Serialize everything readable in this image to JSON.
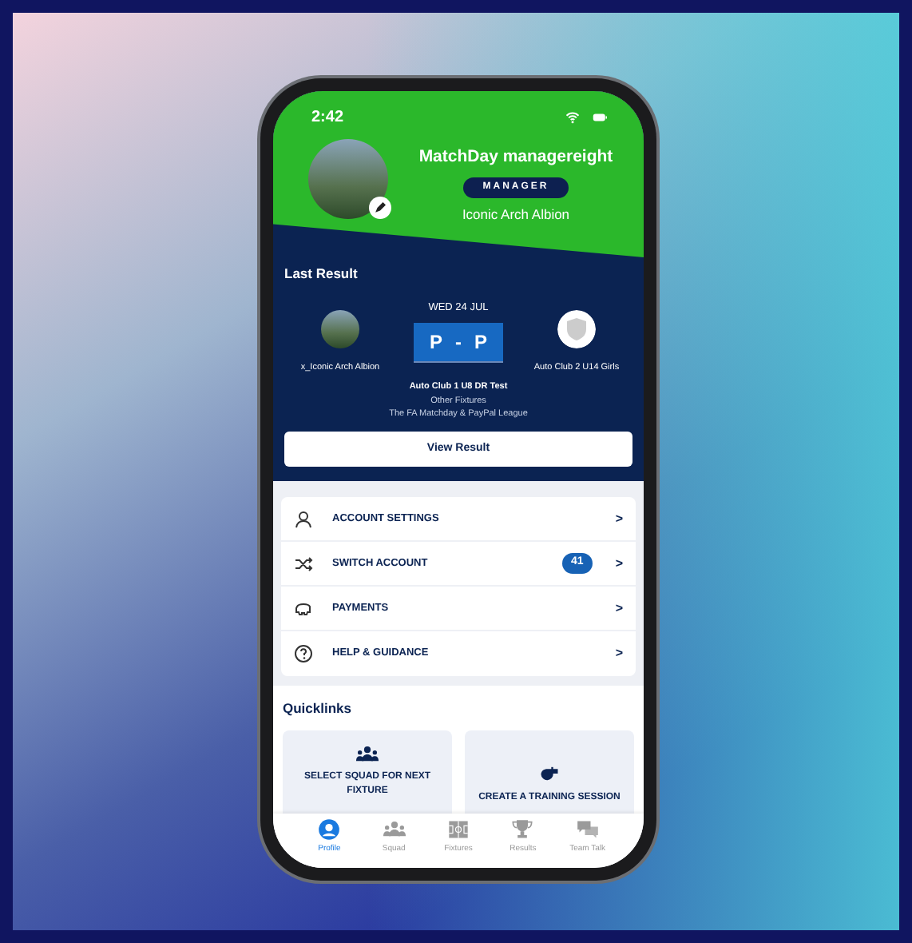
{
  "status_bar": {
    "time": "2:42"
  },
  "profile": {
    "name": "MatchDay managereight",
    "role": "MANAGER",
    "club": "Iconic Arch Albion"
  },
  "last_result": {
    "title": "Last Result",
    "date": "WED 24 JUL",
    "home_team": "x_Iconic Arch Albion",
    "away_team": "Auto Club 2 U14 Girls",
    "score_home": "P",
    "score_separator": "-",
    "score_away": "P",
    "fixture_lines": [
      "Auto Club 1 U8 DR Test",
      "Other Fixtures",
      "The FA Matchday & PayPal League"
    ],
    "button": "View Result"
  },
  "menu": [
    {
      "kind": "account",
      "label": "ACCOUNT SETTINGS",
      "chevron": ">"
    },
    {
      "kind": "switch",
      "label": "SWITCH ACCOUNT",
      "badge": "41",
      "chevron": ">"
    },
    {
      "kind": "payments",
      "label": "PAYMENTS",
      "chevron": ">"
    },
    {
      "kind": "help",
      "label": "HELP & GUIDANCE",
      "chevron": ">"
    }
  ],
  "quicklinks": {
    "title": "Quicklinks",
    "items": [
      {
        "kind": "squad",
        "label": "SELECT SQUAD FOR NEXT FIXTURE"
      },
      {
        "kind": "whistle",
        "label": "CREATE A TRAINING SESSION"
      }
    ]
  },
  "tab_bar": [
    {
      "kind": "profile",
      "label": "Profile",
      "selected": true
    },
    {
      "kind": "squad",
      "label": "Squad",
      "selected": false
    },
    {
      "kind": "fixtures",
      "label": "Fixtures",
      "selected": false
    },
    {
      "kind": "results",
      "label": "Results",
      "selected": false
    },
    {
      "kind": "talk",
      "label": "Team Talk",
      "selected": false
    }
  ]
}
